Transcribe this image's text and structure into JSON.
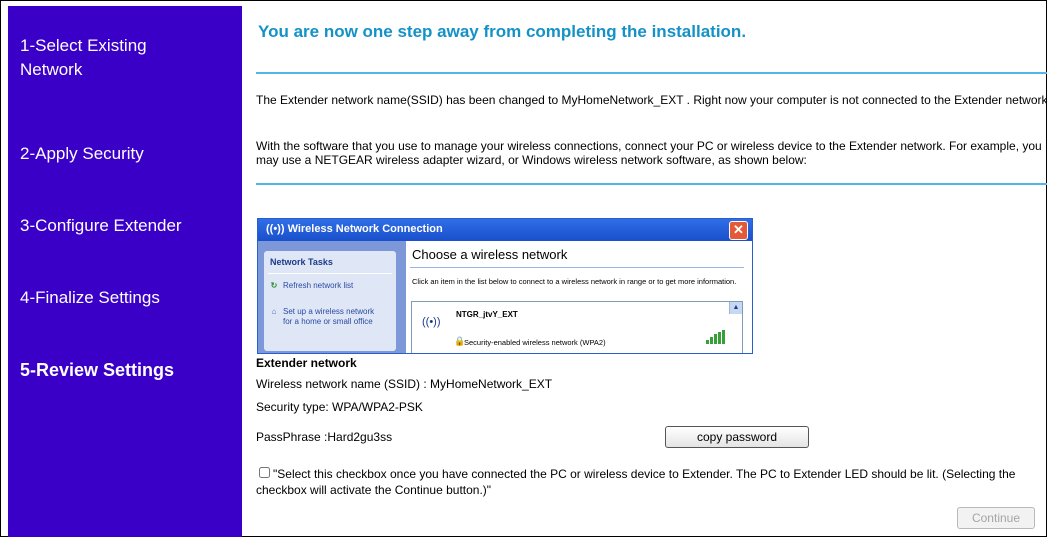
{
  "sidebar": {
    "steps": [
      {
        "label_line1": "1-Select Existing",
        "label_line2": "Network"
      },
      {
        "label": "2-Apply Security"
      },
      {
        "label": "3-Configure Extender"
      },
      {
        "label": "4-Finalize Settings"
      },
      {
        "label": "5-Review Settings"
      }
    ],
    "active_step": 5,
    "background_color": "#3a00c8"
  },
  "main": {
    "heading": "You are now one step away from completing the installation.",
    "heading_color": "#1492c8",
    "para1": "The Extender network name(SSID) has been changed to MyHomeNetwork_EXT . Right now your computer is not connected to the Extender network.",
    "para2": "With the software that you use to manage your wireless connections, connect your PC or wireless device to the Extender network. For example, you may use a NETGEAR wireless adapter wizard, or Windows wireless network software, as shown below:"
  },
  "screenshot": {
    "window_title": "Wireless Network Connection",
    "close_glyph": "✕",
    "tasks_heading": "Network Tasks",
    "task1": "Refresh network list",
    "task2": "Set up a wireless network for a home or small office",
    "choose_heading": "Choose a wireless network",
    "choose_desc": "Click an item in the list below to connect to a wireless network in range or to get more information.",
    "network_name": "NTGR_jtvY_EXT",
    "network_security": "Security-enabled wireless network (WPA2)",
    "icons": [
      "wifi-icon",
      "refresh-icon",
      "setup-network-icon",
      "lock-icon",
      "signal-bars-icon"
    ]
  },
  "extender": {
    "title": "Extender network",
    "ssid_line": "Wireless network name (SSID) : MyHomeNetwork_EXT",
    "security_line": "Security type: WPA/WPA2-PSK",
    "passphrase_line": "PassPhrase :Hard2gu3ss",
    "copy_button": "copy password"
  },
  "confirm": {
    "checkbox_text": "\"Select this checkbox once you have connected the PC or wireless device to Extender. The PC to Extender LED should be lit. (Selecting the checkbox will activate the Continue button.)\"",
    "checked": false,
    "continue_button": "Continue",
    "continue_enabled": false
  }
}
